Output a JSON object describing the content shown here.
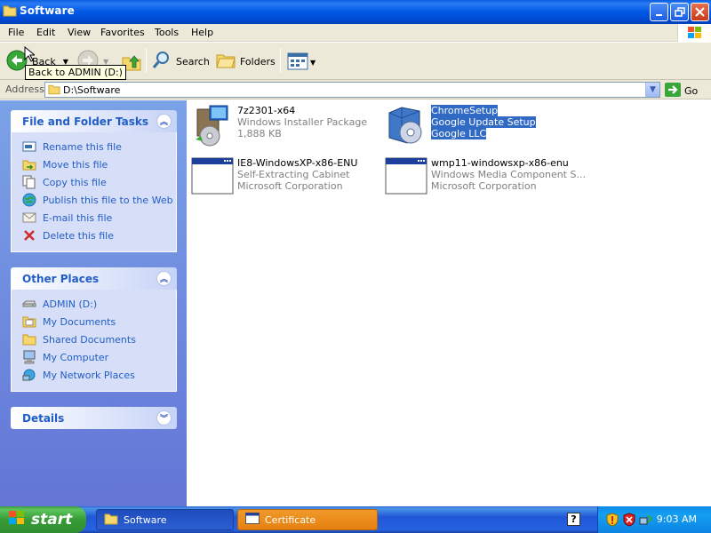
{
  "window": {
    "title": "Software",
    "buttons": {
      "minimize": "_",
      "maximize": "□",
      "close": "✕"
    }
  },
  "menu": [
    "File",
    "Edit",
    "View",
    "Favorites",
    "Tools",
    "Help"
  ],
  "toolbar": {
    "back_label": "Back",
    "back_tooltip": "Back to ADMIN (D:)",
    "search_label": "Search",
    "folders_label": "Folders"
  },
  "address": {
    "label": "Address",
    "value": "D:\\Software",
    "go_label": "Go"
  },
  "tasks_panel": {
    "title": "File and Folder Tasks",
    "items": [
      {
        "label": "Rename this file",
        "icon": "rename-icon"
      },
      {
        "label": "Move this file",
        "icon": "move-icon"
      },
      {
        "label": "Copy this file",
        "icon": "copy-icon"
      },
      {
        "label": "Publish this file to the Web",
        "icon": "globe-icon"
      },
      {
        "label": "E-mail this file",
        "icon": "email-icon"
      },
      {
        "label": "Delete this file",
        "icon": "delete-icon"
      }
    ]
  },
  "places_panel": {
    "title": "Other Places",
    "items": [
      {
        "label": "ADMIN (D:)",
        "icon": "drive-icon"
      },
      {
        "label": "My Documents",
        "icon": "folder-icon"
      },
      {
        "label": "Shared Documents",
        "icon": "folder-icon"
      },
      {
        "label": "My Computer",
        "icon": "computer-icon"
      },
      {
        "label": "My Network Places",
        "icon": "network-icon"
      }
    ]
  },
  "details_panel": {
    "title": "Details"
  },
  "files": [
    {
      "name": "7z2301-x64",
      "type": "Windows Installer Package",
      "info": "1,888 KB",
      "icon": "installer-icon",
      "selected": false
    },
    {
      "name": "ChromeSetup",
      "type": "Google Update Setup",
      "info": "Google LLC",
      "icon": "setup-icon",
      "selected": true
    },
    {
      "name": "IE8-WindowsXP-x86-ENU",
      "type": "Self-Extracting Cabinet",
      "info": "Microsoft Corporation",
      "icon": "application-icon",
      "selected": false
    },
    {
      "name": "wmp11-windowsxp-x86-enu",
      "type": "Windows Media Component S...",
      "info": "Microsoft Corporation",
      "icon": "application-icon",
      "selected": false
    }
  ],
  "taskbar": {
    "start_label": "start",
    "buttons": [
      {
        "label": "Software",
        "icon": "folder-icon"
      },
      {
        "label": "Certificate",
        "icon": "window-icon"
      }
    ],
    "clock": "9:03 AM",
    "help_glyph": "?"
  },
  "colors": {
    "title_blue": "#0058e6",
    "task_link": "#215dc6",
    "selection": "#316ac5",
    "start_green": "#379b37",
    "active_task_orange": "#e68a1a"
  }
}
